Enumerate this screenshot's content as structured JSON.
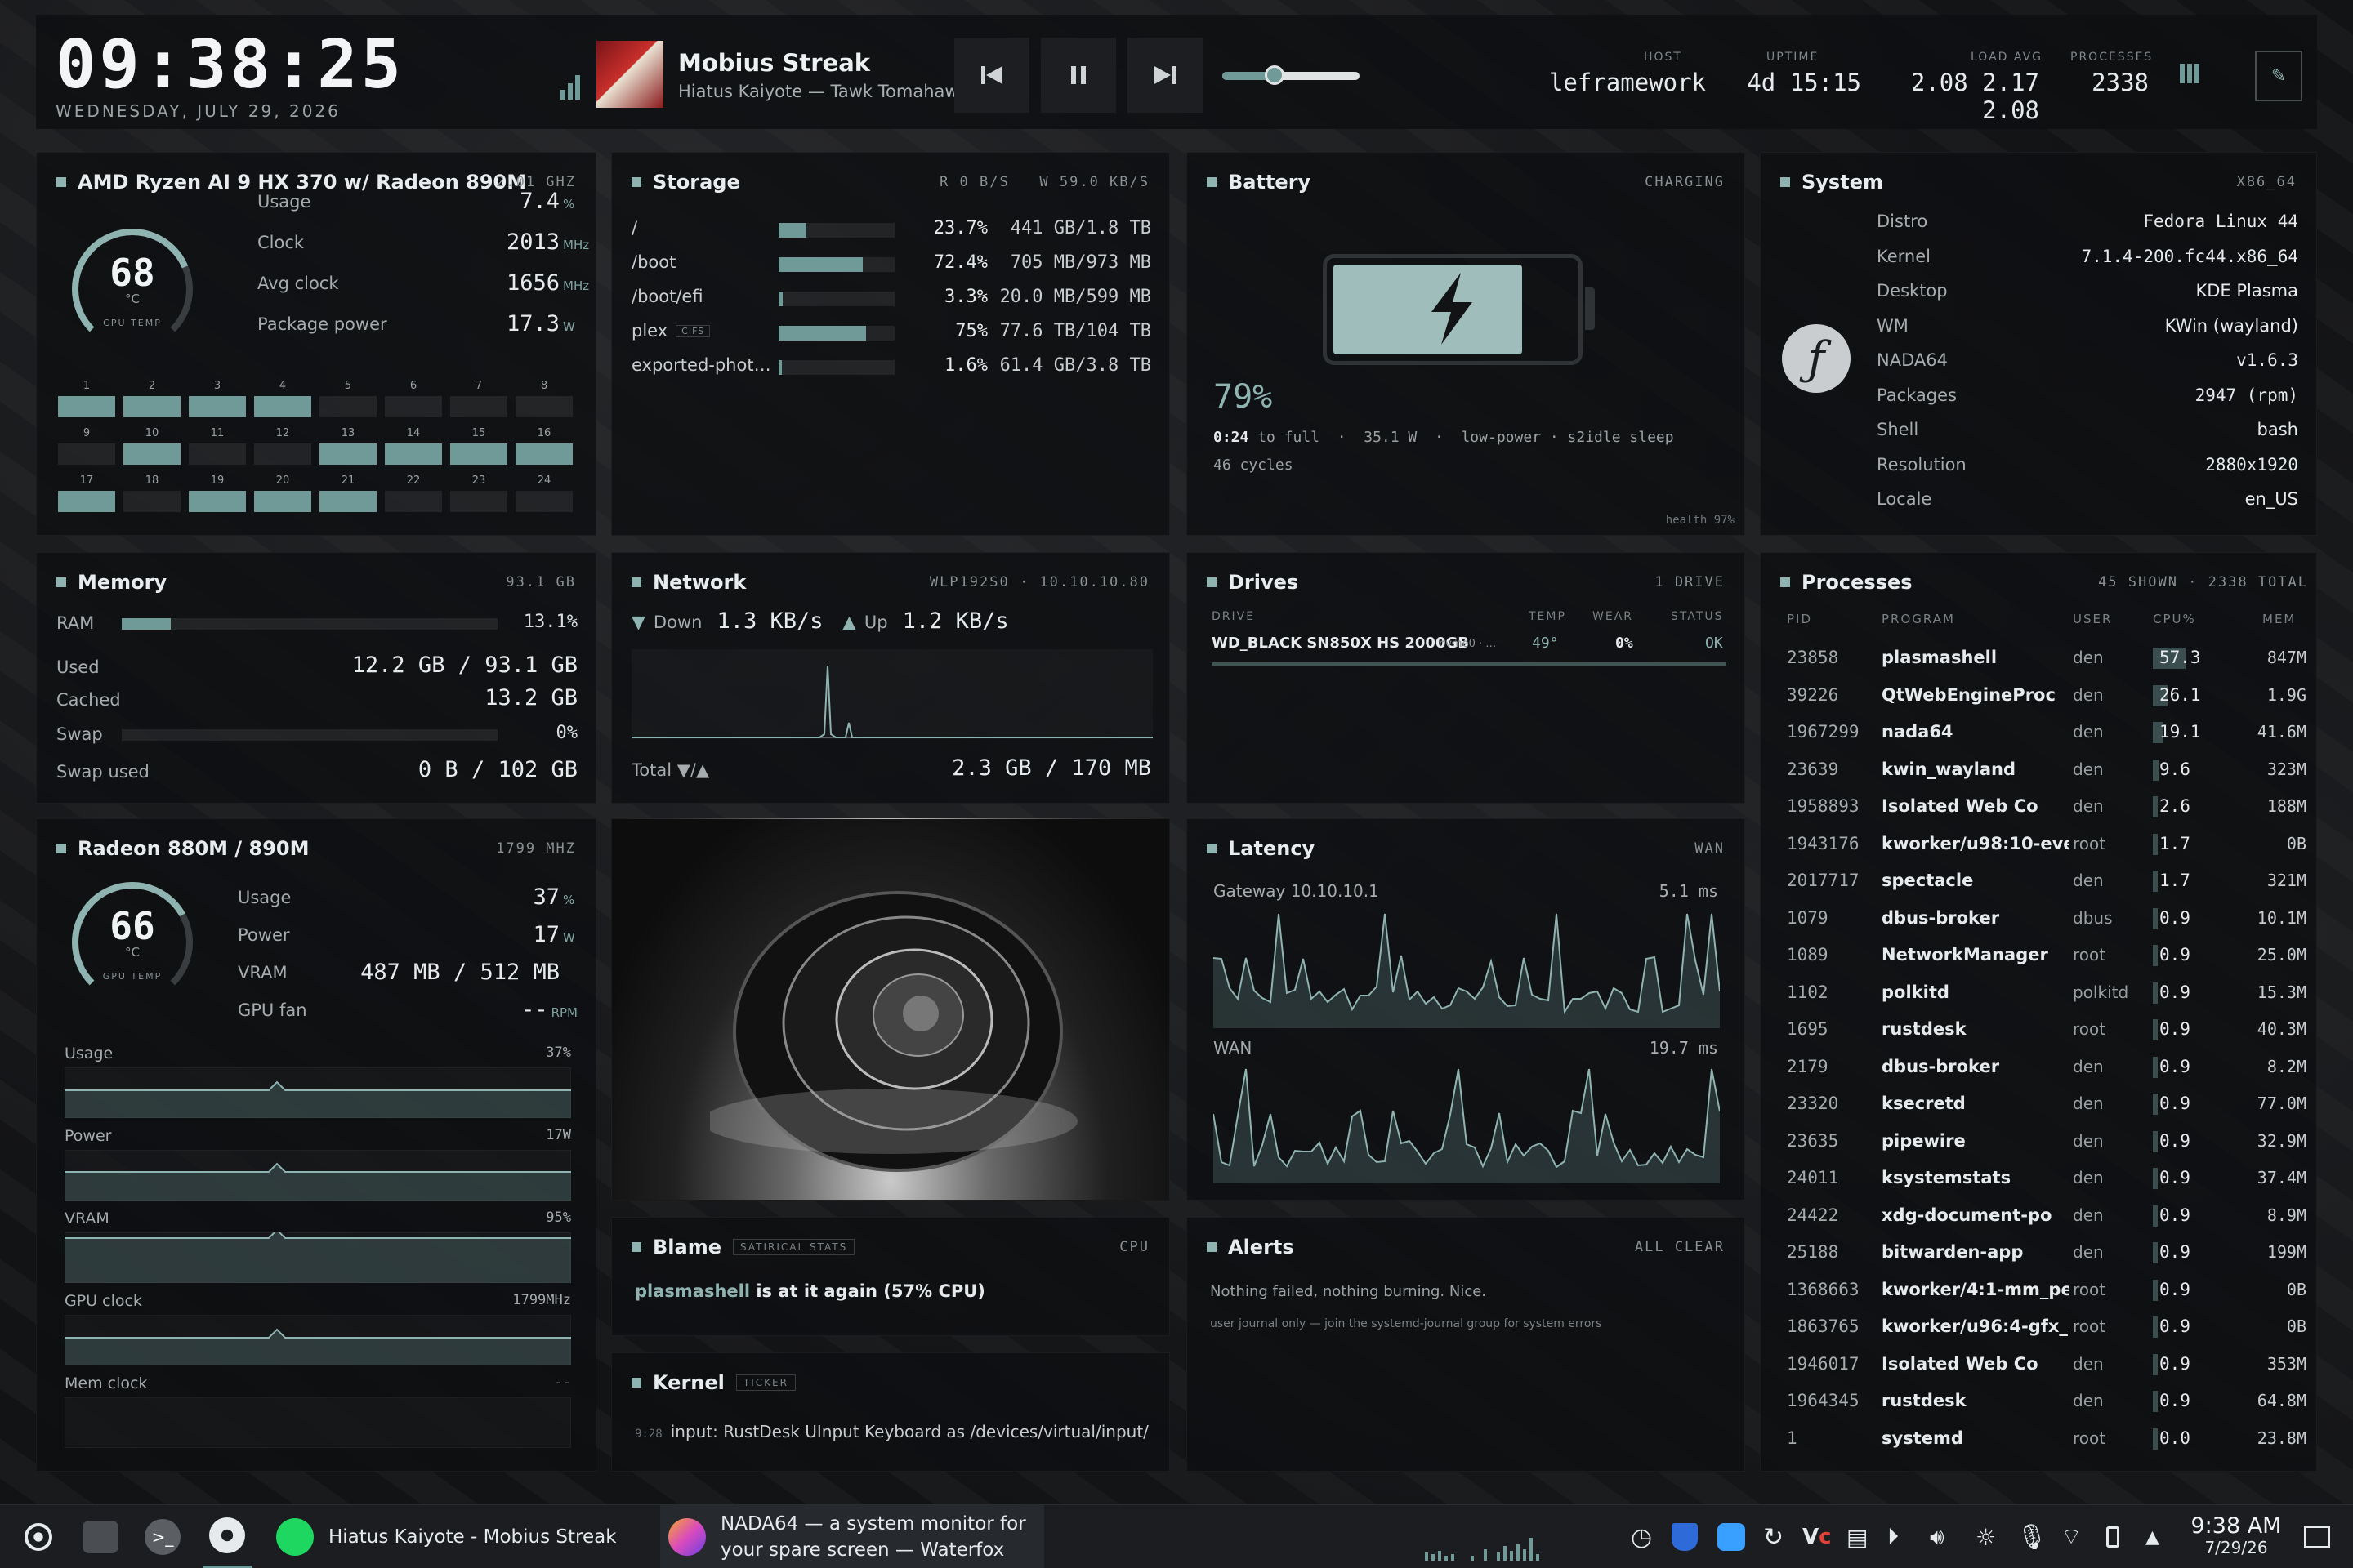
{
  "clock": {
    "time": "09:38:25",
    "date": "WEDNESDAY, JULY 29, 2026"
  },
  "media": {
    "title": "Mobius Streak",
    "subtitle": "Hiatus Kaiyote — Tawk Tomahawk",
    "progress": 0.38
  },
  "header_stats": {
    "host_label": "HOST",
    "host": "leframework",
    "uptime_label": "UPTIME",
    "uptime": "4d 15:15",
    "load_label": "LOAD AVG",
    "load": "2.08 2.17 2.08",
    "proc_label": "PROCESSES",
    "proc": "2338"
  },
  "cpu": {
    "title": "AMD Ryzen AI 9 HX 370 w/ Radeon 890M",
    "freq": "2.01 GHZ",
    "temp": "68",
    "temp_unit": "°C",
    "temp_label": "CPU TEMP",
    "temp_fraction": 0.68,
    "rows": [
      {
        "label": "Usage",
        "value": "7.4",
        "unit": "%"
      },
      {
        "label": "Clock",
        "value": "2013",
        "unit": "MHz"
      },
      {
        "label": "Avg clock",
        "value": "1656",
        "unit": "MHz"
      },
      {
        "label": "Package power",
        "value": "17.3",
        "unit": "W"
      }
    ],
    "cores": [
      {
        "n": "1",
        "on": true
      },
      {
        "n": "2",
        "on": true
      },
      {
        "n": "3",
        "on": true
      },
      {
        "n": "4",
        "on": true
      },
      {
        "n": "5",
        "on": false
      },
      {
        "n": "6",
        "on": false
      },
      {
        "n": "7",
        "on": false
      },
      {
        "n": "8",
        "on": false
      },
      {
        "n": "9",
        "on": false
      },
      {
        "n": "10",
        "on": true
      },
      {
        "n": "11",
        "on": false
      },
      {
        "n": "12",
        "on": false
      },
      {
        "n": "13",
        "on": true
      },
      {
        "n": "14",
        "on": true
      },
      {
        "n": "15",
        "on": true
      },
      {
        "n": "16",
        "on": true
      },
      {
        "n": "17",
        "on": true
      },
      {
        "n": "18",
        "on": false
      },
      {
        "n": "19",
        "on": true
      },
      {
        "n": "20",
        "on": true
      },
      {
        "n": "21",
        "on": true
      },
      {
        "n": "22",
        "on": false
      },
      {
        "n": "23",
        "on": false
      },
      {
        "n": "24",
        "on": false
      }
    ]
  },
  "storage": {
    "title": "Storage",
    "io": "R 0 B/S   W 59.0 KB/S",
    "rows": [
      {
        "mount": "/",
        "tag": "",
        "pct": "23.7%",
        "frac": 0.237,
        "size": "441 GB/1.8 TB"
      },
      {
        "mount": "/boot",
        "tag": "",
        "pct": "72.4%",
        "frac": 0.724,
        "size": "705 MB/973 MB"
      },
      {
        "mount": "/boot/efi",
        "tag": "",
        "pct": "3.3%",
        "frac": 0.033,
        "size": "20.0 MB/599 MB"
      },
      {
        "mount": "plex",
        "tag": "CIFS",
        "pct": "75%",
        "frac": 0.75,
        "size": "77.6 TB/104 TB"
      },
      {
        "mount": "exported-phot…",
        "tag": "",
        "pct": "1.6%",
        "frac": 0.016,
        "size": "61.4 GB/3.8 TB"
      }
    ]
  },
  "battery": {
    "title": "Battery",
    "status": "CHARGING",
    "pct": "79%",
    "level": 0.79,
    "time": "0:24",
    "time_suffix": "to full",
    "watts": "35.1 W",
    "profile": "low-power",
    "sleep": "s2idle sleep",
    "cycles": "46 cycles",
    "health": "health 97%"
  },
  "system": {
    "title": "System",
    "arch": "X86_64",
    "rows": [
      {
        "k": "Distro",
        "v": "Fedora Linux 44"
      },
      {
        "k": "Kernel",
        "v": "7.1.4-200.fc44.x86_64"
      },
      {
        "k": "Desktop",
        "v": "KDE Plasma"
      },
      {
        "k": "WM",
        "v": "KWin (wayland)"
      },
      {
        "k": "NADA64",
        "v": "v1.6.3"
      },
      {
        "k": "Packages",
        "v": "2947 (rpm)"
      },
      {
        "k": "Shell",
        "v": "bash"
      },
      {
        "k": "Resolution",
        "v": "2880x1920"
      },
      {
        "k": "Locale",
        "v": "en_US"
      }
    ]
  },
  "memory": {
    "title": "Memory",
    "total": "93.1 GB",
    "ram_label": "RAM",
    "ram_pct": "13.1%",
    "ram_frac": 0.131,
    "used_label": "Used",
    "used": "12.2 GB / 93.1 GB",
    "cached_label": "Cached",
    "cached": "13.2 GB",
    "swap_label": "Swap",
    "swap_pct": "0%",
    "swap_frac": 0,
    "swapused_label": "Swap used",
    "swapused": "0 B / 102 GB"
  },
  "network": {
    "title": "Network",
    "iface": "WLP192S0 · 10.10.10.80",
    "down_label": "Down",
    "down": "1.3 KB/s",
    "up_label": "Up",
    "up": "1.2 KB/s",
    "total_label": "Total ▼/▲",
    "total": "2.3 GB / 170 MB"
  },
  "drives": {
    "title": "Drives",
    "count": "1 DRIVE",
    "h_drive": "DRIVE",
    "h_temp": "TEMP",
    "h_wear": "WEAR",
    "h_status": "STATUS",
    "name": "WD_BLACK SN850X HS 2000GB",
    "dev": "nvme0 · …",
    "temp": "49°",
    "wear": "0%",
    "status": "OK"
  },
  "processes": {
    "title": "Processes",
    "summary": "45 SHOWN · 2338 TOTAL",
    "h_pid": "PID",
    "h_prog": "PROGRAM",
    "h_user": "USER",
    "h_cpu": "CPU%",
    "h_mem": "MEM",
    "rows": [
      {
        "pid": "23858",
        "prog": "plasmashell",
        "user": "den",
        "cpu": "57.3",
        "mem": "847M",
        "frac": 0.57
      },
      {
        "pid": "39226",
        "prog": "QtWebEngineProc",
        "user": "den",
        "cpu": "26.1",
        "mem": "1.9G",
        "frac": 0.26
      },
      {
        "pid": "1967299",
        "prog": "nada64",
        "user": "den",
        "cpu": "19.1",
        "mem": "41.6M",
        "frac": 0.19
      },
      {
        "pid": "23639",
        "prog": "kwin_wayland",
        "user": "den",
        "cpu": "9.6",
        "mem": "323M",
        "frac": 0.1
      },
      {
        "pid": "1958893",
        "prog": "Isolated Web Co",
        "user": "den",
        "cpu": "2.6",
        "mem": "188M",
        "frac": 0.03
      },
      {
        "pid": "1943176",
        "prog": "kworker/u98:10-eve…",
        "user": "root",
        "cpu": "1.7",
        "mem": "0B",
        "frac": 0.02
      },
      {
        "pid": "2017717",
        "prog": "spectacle",
        "user": "den",
        "cpu": "1.7",
        "mem": "321M",
        "frac": 0.02
      },
      {
        "pid": "1079",
        "prog": "dbus-broker",
        "user": "dbus",
        "cpu": "0.9",
        "mem": "10.1M",
        "frac": 0.01
      },
      {
        "pid": "1089",
        "prog": "NetworkManager",
        "user": "root",
        "cpu": "0.9",
        "mem": "25.0M",
        "frac": 0.01
      },
      {
        "pid": "1102",
        "prog": "polkitd",
        "user": "polkitd",
        "cpu": "0.9",
        "mem": "15.3M",
        "frac": 0.01
      },
      {
        "pid": "1695",
        "prog": "rustdesk",
        "user": "root",
        "cpu": "0.9",
        "mem": "40.3M",
        "frac": 0.01
      },
      {
        "pid": "2179",
        "prog": "dbus-broker",
        "user": "den",
        "cpu": "0.9",
        "mem": "8.2M",
        "frac": 0.01
      },
      {
        "pid": "23320",
        "prog": "ksecretd",
        "user": "den",
        "cpu": "0.9",
        "mem": "77.0M",
        "frac": 0.01
      },
      {
        "pid": "23635",
        "prog": "pipewire",
        "user": "den",
        "cpu": "0.9",
        "mem": "32.9M",
        "frac": 0.01
      },
      {
        "pid": "24011",
        "prog": "ksystemstats",
        "user": "den",
        "cpu": "0.9",
        "mem": "37.4M",
        "frac": 0.01
      },
      {
        "pid": "24422",
        "prog": "xdg-document-po",
        "user": "den",
        "cpu": "0.9",
        "mem": "8.9M",
        "frac": 0.01
      },
      {
        "pid": "25188",
        "prog": "bitwarden-app",
        "user": "den",
        "cpu": "0.9",
        "mem": "199M",
        "frac": 0.01
      },
      {
        "pid": "1368663",
        "prog": "kworker/4:1-mm_pe…",
        "user": "root",
        "cpu": "0.9",
        "mem": "0B",
        "frac": 0.01
      },
      {
        "pid": "1863765",
        "prog": "kworker/u96:4-gfx_…",
        "user": "root",
        "cpu": "0.9",
        "mem": "0B",
        "frac": 0.01
      },
      {
        "pid": "1946017",
        "prog": "Isolated Web Co",
        "user": "den",
        "cpu": "0.9",
        "mem": "353M",
        "frac": 0.01
      },
      {
        "pid": "1964345",
        "prog": "rustdesk",
        "user": "den",
        "cpu": "0.9",
        "mem": "64.8M",
        "frac": 0.01
      },
      {
        "pid": "1",
        "prog": "systemd",
        "user": "root",
        "cpu": "0.0",
        "mem": "23.8M",
        "frac": 0
      }
    ]
  },
  "gpu": {
    "title": "Radeon 880M / 890M",
    "freq": "1799 MHZ",
    "temp": "66",
    "temp_unit": "°C",
    "temp_label": "GPU TEMP",
    "temp_fraction": 0.66,
    "rows": [
      {
        "label": "Usage",
        "value": "37",
        "unit": "%"
      },
      {
        "label": "Power",
        "value": "17",
        "unit": "W"
      },
      {
        "label": "VRAM",
        "value": "487 MB / 512 MB",
        "unit": ""
      },
      {
        "label": "GPU fan",
        "value": "--",
        "unit": "RPM"
      }
    ],
    "graphs": [
      {
        "label": "Usage",
        "value": "37%"
      },
      {
        "label": "Power",
        "value": "17W"
      },
      {
        "label": "VRAM",
        "value": "95%"
      },
      {
        "label": "GPU clock",
        "value": "1799MHz"
      },
      {
        "label": "Mem clock",
        "value": "--"
      }
    ]
  },
  "latency": {
    "title": "Latency",
    "mode": "WAN",
    "gw_label": "Gateway 10.10.10.1",
    "gw_val": "5.1 ms",
    "wan_label": "WAN",
    "wan_val": "19.7 ms"
  },
  "blame": {
    "title": "Blame",
    "tag": "SATIRICAL STATS",
    "right": "CPU",
    "proc": "plasmashell",
    "text": " is at it again (57% CPU)"
  },
  "alerts": {
    "title": "Alerts",
    "status": "ALL CLEAR",
    "msg": "Nothing failed, nothing burning. Nice.",
    "note": "user journal only — join the systemd-journal group for system errors"
  },
  "kernel": {
    "title": "Kernel",
    "tag": "TICKER",
    "time": "9:28",
    "msg": "input: RustDesk UInput Keyboard as /devices/virtual/input/in"
  },
  "taskbar": {
    "task1": "Hiatus Kaiyote - Mobius Streak",
    "task2_line1": "NADA64 — a system monitor for",
    "task2_line2": "your spare screen — Waterfox",
    "time": "9:38 AM",
    "date": "7/29/26"
  },
  "colors": {
    "accent": "#8fb3b0",
    "panel": "#0e0f11"
  }
}
